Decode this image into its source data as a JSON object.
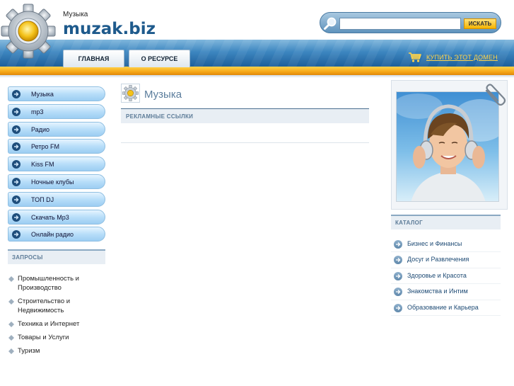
{
  "header": {
    "tagline": "Музыка",
    "site_title": "muzak.biz",
    "search": {
      "value": "",
      "placeholder": "",
      "button_label": "ИСКАТЬ"
    },
    "tabs": [
      {
        "label": "ГЛАВНАЯ"
      },
      {
        "label": "О РЕСУРСЕ"
      }
    ],
    "buy_domain_label": "КУПИТЬ ЭТОТ ДОМЕН"
  },
  "sidebar": {
    "menu": [
      {
        "label": "Музыка"
      },
      {
        "label": "mp3"
      },
      {
        "label": "Радио"
      },
      {
        "label": "Ретро FM"
      },
      {
        "label": "Kiss FM"
      },
      {
        "label": "Ночные клубы"
      },
      {
        "label": "ТОП DJ"
      },
      {
        "label": "Скачать Mp3"
      },
      {
        "label": "Онлайн радио"
      }
    ],
    "requests_title": "ЗАПРОСЫ",
    "requests": [
      {
        "label": "Промышленность и Производство"
      },
      {
        "label": "Строительство и Недвижимость"
      },
      {
        "label": "Техника и Интернет"
      },
      {
        "label": "Товары и Услуги"
      },
      {
        "label": "Туризм"
      }
    ]
  },
  "main": {
    "title": "Музыка",
    "ads_title": "РЕКЛАМНЫЕ ССЫЛКИ"
  },
  "right": {
    "catalog_title": "КАТАЛОГ",
    "catalog": [
      {
        "label": "Бизнес и Финансы"
      },
      {
        "label": "Досуг и Развлечения"
      },
      {
        "label": "Здоровье и Красота"
      },
      {
        "label": "Знакомства и Интим"
      },
      {
        "label": "Образование и Карьера"
      }
    ]
  },
  "colors": {
    "brand_blue": "#1e5a8c",
    "band_blue": "#3d86c0",
    "accent_orange": "#f6a818",
    "link_yellow": "#ffd34a"
  },
  "icons": {
    "logo": "gear-icon",
    "search": "magnifier-icon",
    "cart": "cart-icon",
    "menu_bullet": "arrow-right-icon",
    "request_bullet": "diamond-bullet-icon",
    "photo_clip": "paperclip-icon"
  }
}
